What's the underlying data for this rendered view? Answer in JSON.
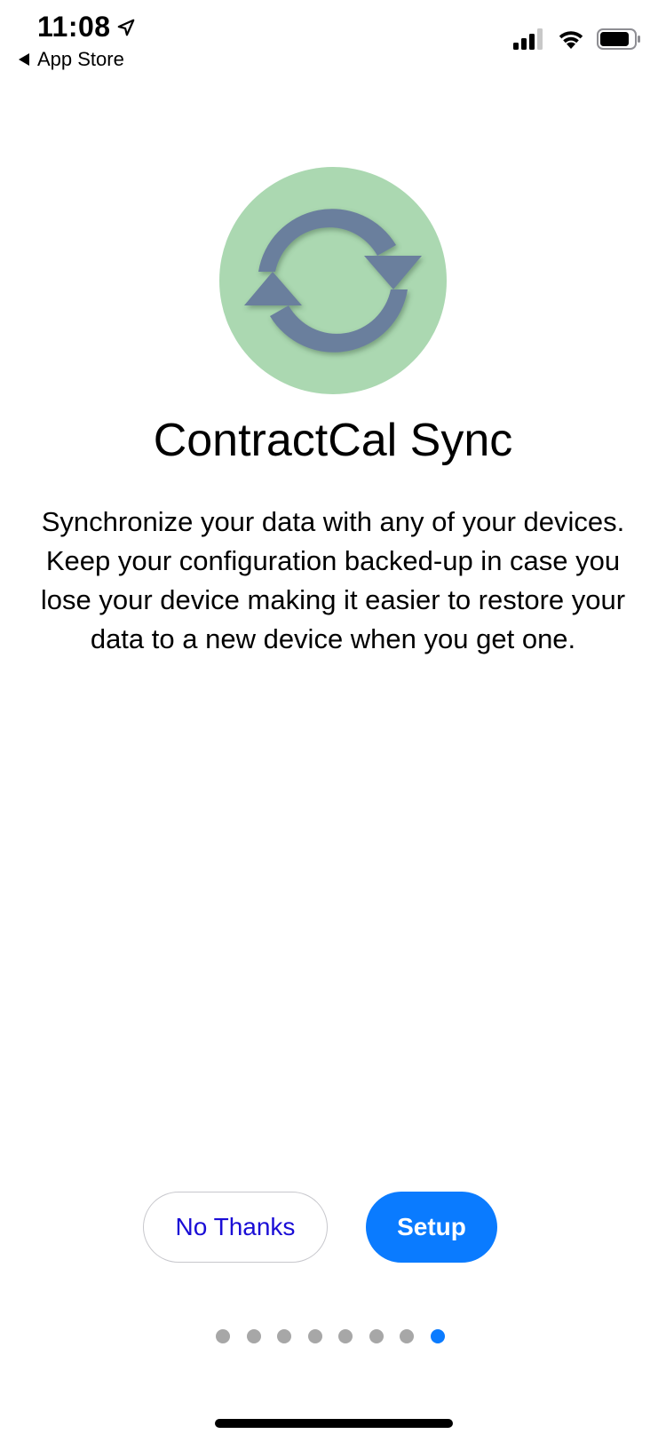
{
  "status_bar": {
    "time": "11:08",
    "back_label": "App Store",
    "icons": [
      "location-arrow-icon",
      "cellular-signal-icon",
      "wifi-icon",
      "battery-icon"
    ]
  },
  "hero": {
    "icon": "sync-arrows-icon",
    "circle_color": "#abd8b1",
    "arrow_color": "#6b7f9d"
  },
  "title": "ContractCal Sync",
  "description": "Synchronize your data with any of your devices. Keep your configuration backed-up in case you lose your device making it easier to restore your data to a new device when you get one.",
  "buttons": {
    "no_thanks": "No Thanks",
    "setup": "Setup"
  },
  "pagination": {
    "total": 8,
    "current": 8
  },
  "colors": {
    "accent": "#0a7bff",
    "link_text": "#1a0dd6",
    "dot_inactive": "#a7a7a7"
  }
}
